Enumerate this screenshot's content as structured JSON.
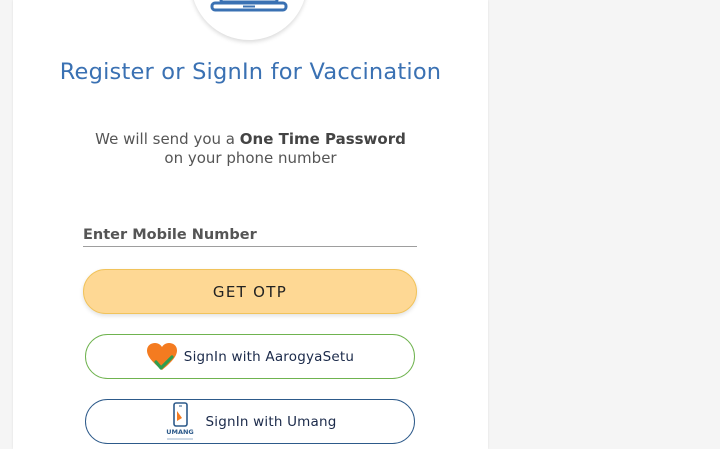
{
  "logo": {
    "icon": "laptop-icon"
  },
  "title": "Register or SignIn for Vaccination",
  "subtitle": {
    "prefix": "We will send you a ",
    "highlight": "One Time Password",
    "suffix": "on your phone number"
  },
  "mobile": {
    "placeholder": "Enter Mobile Number",
    "value": ""
  },
  "otp_button": {
    "label": "GET OTP"
  },
  "aarogya_button": {
    "label": "SignIn with AarogyaSetu",
    "icon": "aarogya-setu-heart-icon"
  },
  "umang_button": {
    "label": "SignIn with Umang",
    "icon": "umang-icon",
    "icon_text": "UMANG"
  },
  "colors": {
    "title": "#3a71b3",
    "otp_fill": "#fed894",
    "aarogya_border": "#6fb34f",
    "umang_border": "#2d5a8a"
  }
}
